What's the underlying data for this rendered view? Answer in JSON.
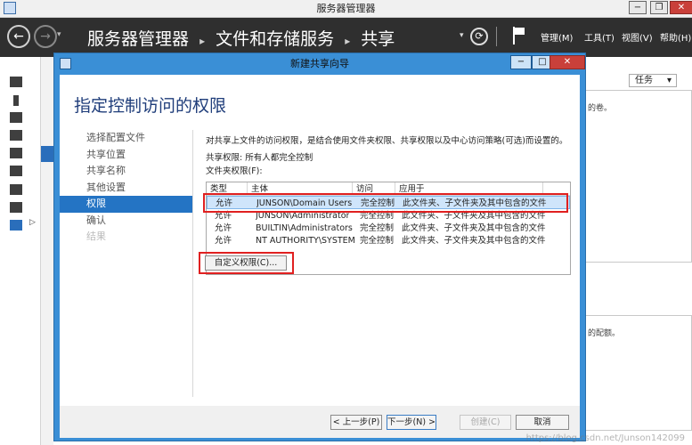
{
  "window": {
    "title": "服务器管理器",
    "min_glyph": "−",
    "max_glyph": "❐",
    "close_glyph": "✕"
  },
  "nav": {
    "back_glyph": "←",
    "forward_glyph": "→",
    "breadcrumb": [
      "服务器管理器",
      "文件和存储服务",
      "共享"
    ],
    "separator": "▸",
    "refresh_glyph": "⟳",
    "menu_manage": "管理(M)",
    "menu_tools": "工具(T)",
    "menu_view": "视图(V)",
    "menu_help": "帮助(H)"
  },
  "background": {
    "task_dropdown": "任务",
    "task_dropdown_glyph": "▾",
    "panel_text_top": "的卷。",
    "panel_text_bottom": "的配额。"
  },
  "dialog": {
    "title": "新建共享向导",
    "heading": "指定控制访问的权限",
    "steps": [
      {
        "label": "选择配置文件",
        "state": "normal"
      },
      {
        "label": "共享位置",
        "state": "normal"
      },
      {
        "label": "共享名称",
        "state": "normal"
      },
      {
        "label": "其他设置",
        "state": "normal"
      },
      {
        "label": "权限",
        "state": "active"
      },
      {
        "label": "确认",
        "state": "normal"
      },
      {
        "label": "结果",
        "state": "disabled"
      }
    ],
    "description": "对共享上文件的访问权限，是结合使用文件夹权限、共享权限以及中心访问策略(可选)而设置的。",
    "share_permission": "共享权限: 所有人都完全控制",
    "folder_permission_label": "文件夹权限(F):",
    "table": {
      "headers": [
        "类型",
        "主体",
        "访问",
        "应用于"
      ],
      "rows": [
        {
          "type": "允许",
          "principal": "JUNSON\\Domain Users",
          "access": "完全控制",
          "applies_to": "此文件夹、子文件夹及其中包含的文件"
        },
        {
          "type": "允许",
          "principal": "JUNSON\\Administrator",
          "access": "完全控制",
          "applies_to": "此文件夹、子文件夹及其中包含的文件"
        },
        {
          "type": "允许",
          "principal": "BUILTIN\\Administrators",
          "access": "完全控制",
          "applies_to": "此文件夹、子文件夹及其中包含的文件"
        },
        {
          "type": "允许",
          "principal": "NT AUTHORITY\\SYSTEM",
          "access": "完全控制",
          "applies_to": "此文件夹、子文件夹及其中包含的文件"
        }
      ]
    },
    "custom_permissions_button": "自定义权限(C)...",
    "buttons": {
      "prev": "< 上一步(P)",
      "next": "下一步(N) >",
      "create": "创建(C)",
      "cancel": "取消"
    }
  },
  "watermark": "https://blog.csdn.net/Junson142099",
  "colors": {
    "accent": "#2474c4",
    "dialog_frame": "#3a8fd6",
    "highlight_red": "#e02020",
    "nav_dark": "#2f2f2f"
  }
}
